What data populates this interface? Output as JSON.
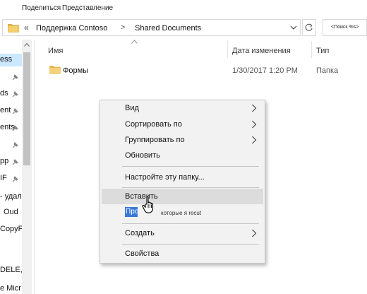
{
  "ribbon": {
    "tabs": [
      "Поделиться",
      "Представление"
    ]
  },
  "address": {
    "crumb_sep": "«",
    "crumbs": [
      "Поддержка Contoso",
      "Shared Documents"
    ],
    "arrow": ">",
    "search_placeholder": "<Поиск %s>"
  },
  "nav": {
    "items": [
      "ess",
      "ds",
      "ent",
      "ents",
      "pp",
      "IF",
      "- удалить",
      "Oud",
      "CopyF",
      "DELE,",
      "e Micr"
    ]
  },
  "list": {
    "columns": {
      "name": "Имя",
      "date": "Дата изменения",
      "type": "Тип"
    },
    "rows": [
      {
        "name": "Формы",
        "date": "1/30/2017 1:20 PM",
        "type": "Папка"
      }
    ]
  },
  "context_menu": {
    "items": [
      {
        "label": "Вид",
        "submenu": true
      },
      {
        "label": "Сортировать по",
        "submenu": true
      },
      {
        "label": "Группировать по",
        "submenu": true
      },
      {
        "label": "Обновить",
        "submenu": false
      },
      {
        "label": "Настройте эту папку...",
        "submenu": false
      },
      {
        "label": "Вставить",
        "submenu": false
      },
      {
        "label": "Про",
        "submenu": false
      },
      {
        "label": "Создать",
        "submenu": true
      },
      {
        "label": "Свойства",
        "submenu": false
      }
    ],
    "paste_shortcut_tail": "которые я recut"
  },
  "colors": {
    "hover": "#dcdcdc",
    "selection": "#3879d9",
    "nav_selected": "#cce8ff",
    "folder": "#e8b84a"
  },
  "icons": [
    "folder-icon",
    "chevron-down-icon",
    "refresh-icon",
    "pin-icon",
    "chevron-right-icon",
    "hand-cursor-icon",
    "sort-up-icon"
  ]
}
